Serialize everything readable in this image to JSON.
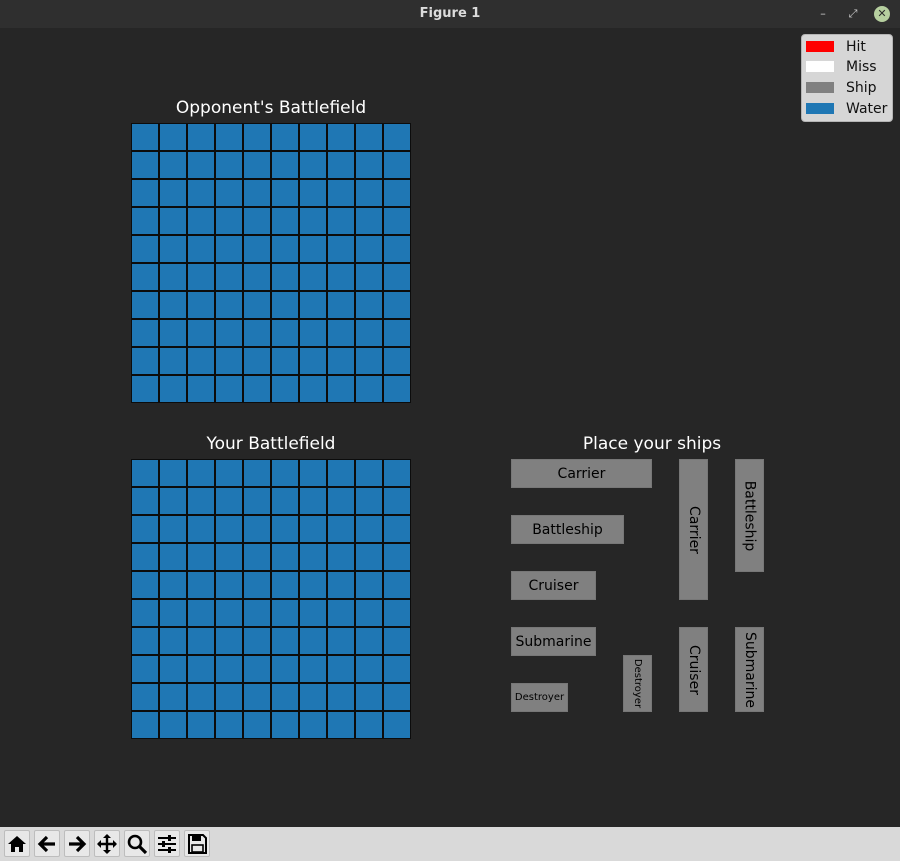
{
  "window": {
    "title": "Figure 1",
    "minimize": "–",
    "maximize": "⤢",
    "close": "✕"
  },
  "boards": {
    "opponent_title": "Opponent's Battlefield",
    "player_title": "Your Battlefield",
    "rows": 10,
    "cols": 10,
    "cell_state": "Water"
  },
  "placement": {
    "title": "Place your ships",
    "ships": [
      {
        "label": "Carrier",
        "orientation": "horizontal"
      },
      {
        "label": "Battleship",
        "orientation": "horizontal"
      },
      {
        "label": "Cruiser",
        "orientation": "horizontal"
      },
      {
        "label": "Submarine",
        "orientation": "horizontal"
      },
      {
        "label": "Destroyer",
        "orientation": "horizontal"
      },
      {
        "label": "Destroyer",
        "orientation": "vertical"
      },
      {
        "label": "Carrier",
        "orientation": "vertical"
      },
      {
        "label": "Cruiser",
        "orientation": "vertical"
      },
      {
        "label": "Battleship",
        "orientation": "vertical"
      },
      {
        "label": "Submarine",
        "orientation": "vertical"
      }
    ]
  },
  "legend": [
    {
      "label": "Hit",
      "color": "#ff0000"
    },
    {
      "label": "Miss",
      "color": "#ffffff"
    },
    {
      "label": "Ship",
      "color": "#808080"
    },
    {
      "label": "Water",
      "color": "#1f77b4"
    }
  ],
  "toolbar": [
    "home-icon",
    "back-icon",
    "forward-icon",
    "pan-icon",
    "zoom-icon",
    "configure-icon",
    "save-icon"
  ]
}
